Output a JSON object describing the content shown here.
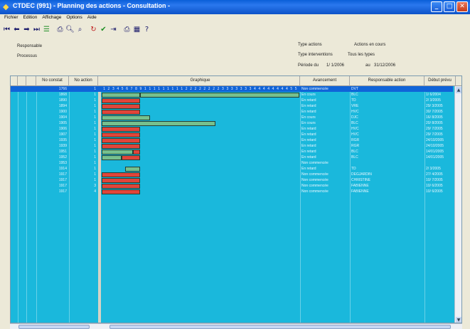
{
  "window": {
    "title": "CTDEC (991) - Planning des actions - Consultation -"
  },
  "menu": [
    "Fichier",
    "Edition",
    "Affichage",
    "Options",
    "Aide"
  ],
  "toolbar_icons": [
    "first-icon",
    "prev-icon",
    "next-icon",
    "last-icon",
    "filter-icon",
    "print-preview-icon",
    "zoom-icon",
    "find-icon",
    "refresh-icon",
    "check-icon",
    "export-icon",
    "print-icon",
    "chart-icon",
    "help-icon"
  ],
  "criteria": {
    "responsable_label": "Responsable",
    "processus_label": "Processus",
    "type_actions_label": "Type actions",
    "type_actions_value": "Actions en cours",
    "type_interventions_label": "Type interventions",
    "type_interventions_value": "Tous les types",
    "periode_label": "Période du",
    "periode_from": "1/ 1/2006",
    "periode_to_label": "au",
    "periode_to": "31/12/2006"
  },
  "columns": [
    "No constat",
    "No action",
    "Graphique",
    "Avancement",
    "Responsable action",
    "Début prévu"
  ],
  "scale": "1 2 3 4 5 6 7 8 9 1 1 1 1 1 1 1 1 1 2 2 2 2 2 2 2 2 3 3 3 3 3 3 3 4 4 4 4 4 4 4 4 5 5",
  "rows": [
    {
      "constat": "1766",
      "action": "1",
      "avancement": "Non commencée",
      "responsable": "DVT",
      "debut": ""
    },
    {
      "constat": "1868",
      "action": "1",
      "avancement": "En cours",
      "responsable": "BLC",
      "debut": "1/ 6/2004"
    },
    {
      "constat": "1890",
      "action": "1",
      "avancement": "En retard",
      "responsable": "TD",
      "debut": "2/ 3/2005"
    },
    {
      "constat": "1894",
      "action": "1",
      "avancement": "En retard",
      "responsable": "VRE",
      "debut": "29/ 3/2005"
    },
    {
      "constat": "1900",
      "action": "1",
      "avancement": "En retard",
      "responsable": "HVC",
      "debut": "30/ 7/2005"
    },
    {
      "constat": "1904",
      "action": "1",
      "avancement": "En cours",
      "responsable": "DJC",
      "debut": "16/ 8/2005"
    },
    {
      "constat": "1905",
      "action": "1",
      "avancement": "En cours",
      "responsable": "BLC",
      "debut": "20/ 8/2005"
    },
    {
      "constat": "1906",
      "action": "1",
      "avancement": "En retard",
      "responsable": "HVC",
      "debut": "29/ 7/2005"
    },
    {
      "constat": "1907",
      "action": "1",
      "avancement": "En retard",
      "responsable": "HVC",
      "debut": "29/ 7/2005"
    },
    {
      "constat": "1935",
      "action": "1",
      "avancement": "En retard",
      "responsable": "RGR",
      "debut": "24/10/2005"
    },
    {
      "constat": "1939",
      "action": "1",
      "avancement": "En retard",
      "responsable": "RGR",
      "debut": "24/10/2005"
    },
    {
      "constat": "1951",
      "action": "1",
      "avancement": "En retard",
      "responsable": "BLC",
      "debut": "14/01/2005"
    },
    {
      "constat": "1952",
      "action": "1",
      "avancement": "En retard",
      "responsable": "BLC",
      "debut": "14/01/2005"
    },
    {
      "constat": "1953",
      "action": "1",
      "avancement": "Non commencée",
      "responsable": "",
      "debut": ""
    },
    {
      "constat": "1914",
      "action": "1",
      "avancement": "En retard",
      "responsable": "TD",
      "debut": "2/ 3/2005"
    },
    {
      "constat": "1917",
      "action": "1",
      "avancement": "Non commencée",
      "responsable": "DEGJARDIN",
      "debut": "27/ 4/2005"
    },
    {
      "constat": "1917",
      "action": "1",
      "avancement": "Non commencée",
      "responsable": "CHRISTINE",
      "debut": "10/ 7/2005"
    },
    {
      "constat": "1917",
      "action": "3",
      "avancement": "Non commencée",
      "responsable": "FABIENNE",
      "debut": "10/ 6/2005"
    },
    {
      "constat": "1917",
      "action": "4",
      "avancement": "Non commencée",
      "responsable": "FABIENNE",
      "debut": "10/ 6/2005"
    }
  ],
  "gantt": [
    {
      "row": 1,
      "segments": [
        {
          "start": 0,
          "end": 0.193,
          "color": "green"
        },
        {
          "start": 0.193,
          "end": 1.0,
          "color": "green"
        }
      ]
    },
    {
      "row": 2,
      "segments": [
        {
          "start": 0,
          "end": 0.193,
          "color": "red"
        }
      ]
    },
    {
      "row": 3,
      "segments": [
        {
          "start": 0,
          "end": 0.193,
          "color": "red"
        }
      ]
    },
    {
      "row": 4,
      "segments": [
        {
          "start": 0,
          "end": 0.193,
          "color": "red"
        }
      ]
    },
    {
      "row": 5,
      "segments": [
        {
          "start": 0,
          "end": 0.243,
          "color": "green"
        }
      ]
    },
    {
      "row": 6,
      "segments": [
        {
          "start": 0,
          "end": 0.574,
          "color": "green"
        }
      ]
    },
    {
      "row": 7,
      "segments": [
        {
          "start": 0,
          "end": 0.193,
          "color": "red"
        }
      ]
    },
    {
      "row": 8,
      "segments": [
        {
          "start": 0,
          "end": 0.193,
          "color": "red"
        }
      ]
    },
    {
      "row": 9,
      "segments": [
        {
          "start": 0,
          "end": 0.193,
          "color": "red"
        }
      ]
    },
    {
      "row": 10,
      "segments": [
        {
          "start": 0,
          "end": 0.193,
          "color": "red"
        }
      ]
    },
    {
      "row": 11,
      "segments": [
        {
          "start": 0,
          "end": 0.158,
          "color": "green"
        },
        {
          "start": 0.158,
          "end": 0.193,
          "color": "red"
        }
      ]
    },
    {
      "row": 12,
      "segments": [
        {
          "start": 0,
          "end": 0.099,
          "color": "green"
        },
        {
          "start": 0.099,
          "end": 0.193,
          "color": "red"
        }
      ]
    },
    {
      "row": 14,
      "segments": [
        {
          "start": 0.119,
          "end": 0.193,
          "color": "green"
        }
      ]
    },
    {
      "row": 15,
      "segments": [
        {
          "start": 0,
          "end": 0.193,
          "color": "red"
        }
      ]
    },
    {
      "row": 16,
      "segments": [
        {
          "start": 0,
          "end": 0.193,
          "color": "red"
        }
      ]
    },
    {
      "row": 17,
      "segments": [
        {
          "start": 0,
          "end": 0.193,
          "color": "red"
        }
      ]
    },
    {
      "row": 18,
      "segments": [
        {
          "start": 0,
          "end": 0.193,
          "color": "red"
        }
      ]
    }
  ]
}
